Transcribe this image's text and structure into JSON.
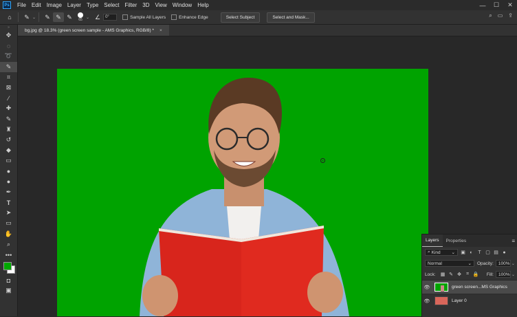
{
  "menubar": {
    "app_icon": "Ps",
    "items": [
      "File",
      "Edit",
      "Image",
      "Layer",
      "Type",
      "Select",
      "Filter",
      "3D",
      "View",
      "Window",
      "Help"
    ],
    "window_controls": [
      "minimize-icon",
      "maximize-icon",
      "close-icon"
    ]
  },
  "options_bar": {
    "brush_size": "65",
    "angle_value": "0°",
    "sample_all_layers": "Sample All Layers",
    "enhance_edge": "Enhance Edge",
    "select_subject": "Select Subject",
    "select_and_mask": "Select and Mask..."
  },
  "document": {
    "tab_title": "bg.jpg @ 18.3% (green screen sample - AMS Graphics, RGB/8) *",
    "close_glyph": "×",
    "background_color": "#00a300"
  },
  "colors": {
    "foreground": "#00a800",
    "background": "#ffffff"
  },
  "layers_panel": {
    "tabs": [
      "Layers",
      "Properties"
    ],
    "filter_kind": "Kind",
    "blend_mode": "Normal",
    "opacity_label": "Opacity:",
    "opacity_value": "100%",
    "lock_label": "Lock:",
    "fill_label": "Fill:",
    "fill_value": "100%",
    "layers": [
      {
        "name": "green screen...MS Graphics",
        "selected": true
      },
      {
        "name": "Layer 0",
        "selected": false
      }
    ]
  }
}
